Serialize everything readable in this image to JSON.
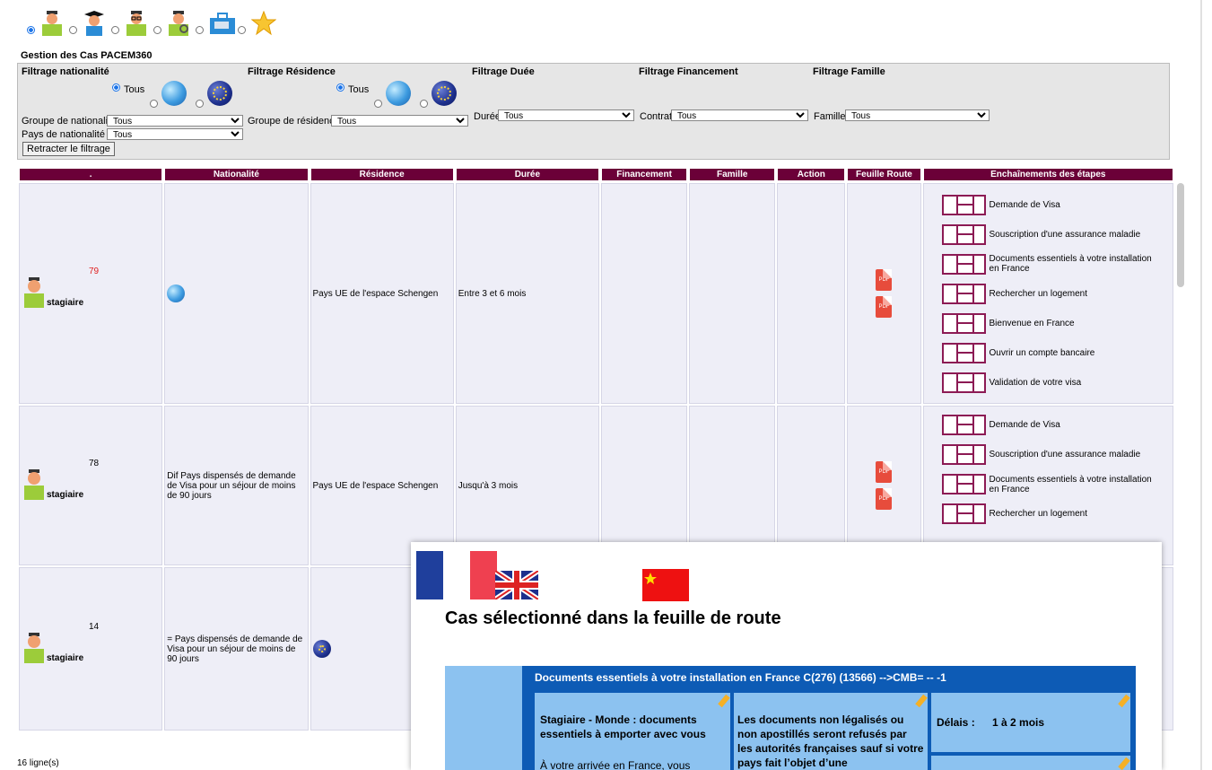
{
  "page": {
    "title": "Gestion des Cas PACEM360"
  },
  "filters": {
    "nationalite": {
      "heading": "Filtrage nationalité",
      "radio_label": "Tous",
      "group_label": "Groupe de nationalité",
      "group_value": "Tous",
      "pays_label": "Pays de nationalité",
      "pays_value": "Tous"
    },
    "residence": {
      "heading": "Filtrage Résidence",
      "radio_label": "Tous",
      "group_label": "Groupe de résidence",
      "group_value": "Tous"
    },
    "duree": {
      "heading": "Filtrage Duée",
      "label": "Durée",
      "value": "Tous"
    },
    "financement": {
      "heading": "Filtrage Financement",
      "label": "Contrat",
      "value": "Tous"
    },
    "famille": {
      "heading": "Filtrage Famille",
      "label": "Famille",
      "value": "Tous"
    },
    "retract_button": "Retracter le filtrage"
  },
  "table": {
    "headers": [
      ".",
      "Nationalité",
      "Résidence",
      "Durée",
      "Financement",
      "Famille",
      "Action",
      "Feuille Route",
      "Enchaînements des étapes"
    ],
    "rows": [
      {
        "id": "79",
        "role": "stagiaire",
        "nationalite": "",
        "residence": "Pays UE de l'espace Schengen",
        "duree": "Entre 3 et 6 mois",
        "steps": [
          "Demande de Visa",
          "Souscription d'une assurance maladie",
          "Documents essentiels à votre installation en France",
          "Rechercher un logement",
          "Bienvenue en France",
          "Ouvrir un compte bancaire",
          "Validation de votre visa"
        ]
      },
      {
        "id": "78",
        "role": "stagiaire",
        "nationalite": "Dif Pays dispensés de demande de Visa pour un séjour de moins de 90 jours",
        "residence": "Pays UE de l'espace Schengen",
        "duree": "Jusqu'à 3 mois",
        "steps": [
          "Demande de Visa",
          "Souscription d'une assurance maladie",
          "Documents essentiels à votre installation en France",
          "Rechercher un logement"
        ]
      },
      {
        "id": "14",
        "role": "stagiaire",
        "nationalite": "= Pays dispensés de demande de Visa pour un séjour de moins de 90 jours",
        "residence": "",
        "duree": "",
        "steps": []
      }
    ],
    "pdf_label": "PDF"
  },
  "footer": {
    "count": "16 ligne(s)"
  },
  "popup": {
    "title": "Cas sélectionné dans la feuille de route",
    "road_header": "Documents essentiels à votre installation en France C(276) (13566) -->CMB= -- -1",
    "card1": "Stagiaire - Monde : documents essentiels à emporter avec vous",
    "card1_sub": "À votre arrivée en France, vous",
    "card2": "Les documents non légalisés ou non apostillés seront refusés par les autorités françaises sauf si votre pays fait l’objet d’une",
    "card3_label": "Délais :",
    "card3_value": "1 à 2 mois"
  },
  "colors": {
    "header_bg": "#6b0038",
    "row_bg": "#eeeef7",
    "road_bg": "#0d5bb5",
    "card_bg": "#8cc2f0"
  }
}
